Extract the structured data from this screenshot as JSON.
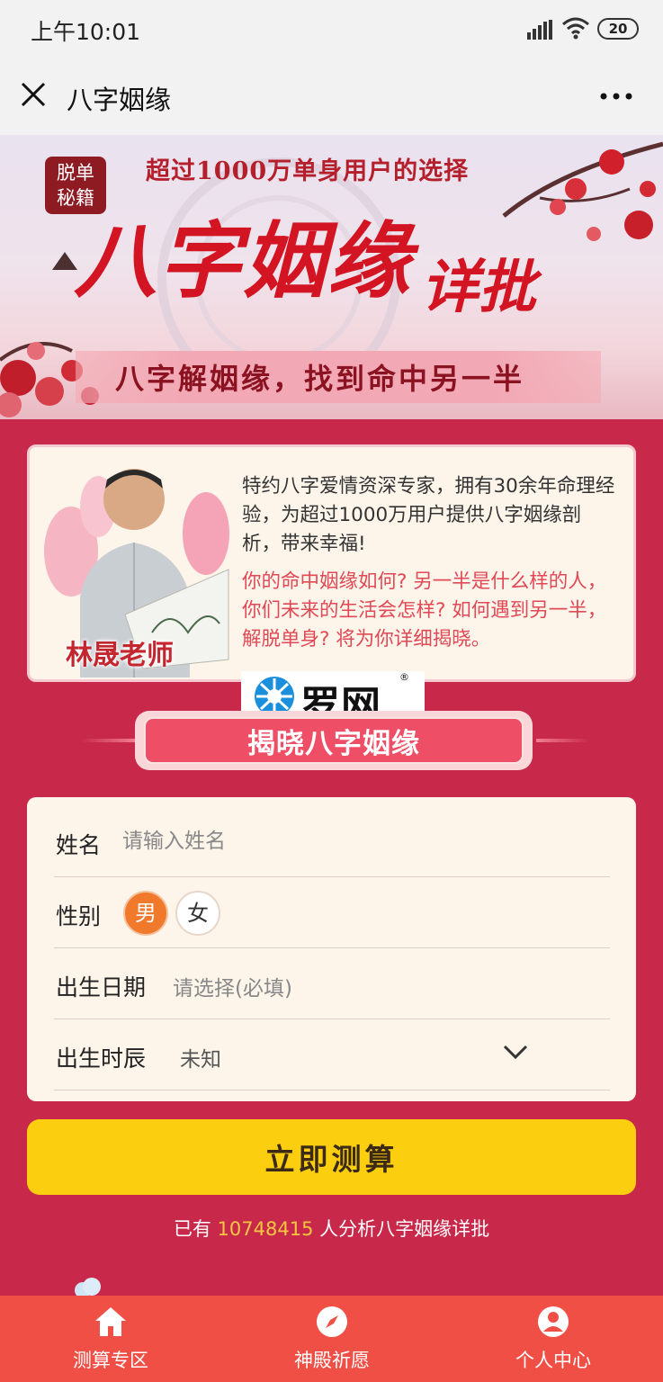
{
  "status_bar": {
    "time": "上午10:01",
    "battery": "20"
  },
  "nav": {
    "title": "八字姻缘"
  },
  "banner": {
    "seal_text": "脱单秘籍",
    "tagline": "超过1000万单身用户的选择",
    "title_main": "八字姻缘",
    "title_small": "详批",
    "subtitle": "八字解姻缘，找到命中另一半"
  },
  "expert": {
    "name": "林晟老师",
    "bio": "特约八字爱情资深专家，拥有30余年命理经验，为超过1000万用户提供八字姻缘剖析，带来幸福!",
    "question": "你的命中姻缘如何? 另一半是什么样的人，你们未来的生活会怎样? 如何遇到另一半，解脱单身? 将为你详细揭晓。"
  },
  "watermark": {
    "text": "罗网",
    "reg": "®"
  },
  "section": {
    "title": "揭晓八字姻缘"
  },
  "form": {
    "name_label": "姓名",
    "name_placeholder": "请输入姓名",
    "gender_label": "性别",
    "gender_male": "男",
    "gender_female": "女",
    "gender_selected": "男",
    "birth_date_label": "出生日期",
    "birth_date_placeholder": "请选择(必填)",
    "birth_hour_label": "出生时辰",
    "birth_hour_value": "未知"
  },
  "submit": {
    "label": "立即测算"
  },
  "stats": {
    "prefix": "已有 ",
    "count": "10748415",
    "suffix": " 人分析八字姻缘详批"
  },
  "tabs": [
    {
      "label": "测算专区",
      "icon": "home-icon"
    },
    {
      "label": "神殿祈愿",
      "icon": "compass-icon"
    },
    {
      "label": "个人中心",
      "icon": "user-icon"
    }
  ],
  "colors": {
    "page_bg": "#c8284a",
    "accent_yellow": "#fbcf0f",
    "tab_bar": "#f04f46",
    "male_selected": "#f0792b"
  }
}
